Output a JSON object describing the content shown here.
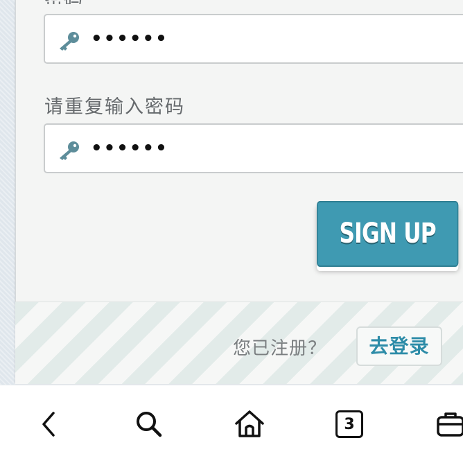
{
  "form": {
    "password_label": "密码",
    "password_value": "••••••",
    "confirm_label": "请重复输入密码",
    "confirm_value": "••••••",
    "signup_label": "SIGN UP"
  },
  "footer": {
    "already_text": "您已注册？",
    "login_label": "去登录"
  },
  "browser_nav": {
    "items": [
      "back-icon",
      "search-icon",
      "home-icon",
      "tabs-icon",
      "briefcase-icon"
    ],
    "tab_count": "3"
  },
  "colors": {
    "accent": "#3f9ab2",
    "key_icon": "#5d8d9a",
    "login_text": "#2d8ca8"
  }
}
